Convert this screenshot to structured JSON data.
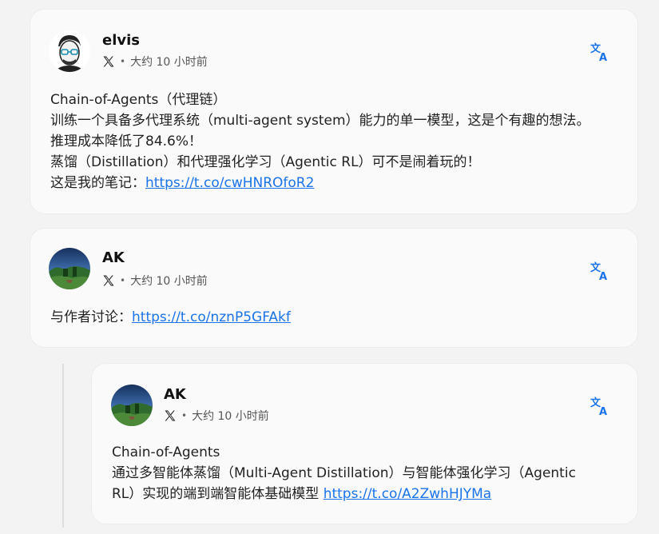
{
  "posts": [
    {
      "author": "elvis",
      "time": "大约 10 小时前",
      "lines": [
        "Chain-of-Agents（代理链）",
        "训练一个具备多代理系统（multi-agent system）能力的单一模型，这是个有趣的想法。",
        "推理成本降低了84.6%！",
        "蒸馏（Distillation）和代理强化学习（Agentic RL）可不是闹着玩的！"
      ],
      "link_prefix": "这是我的笔记：",
      "link": "https://t.co/cwHNROfoR2"
    },
    {
      "author": "AK",
      "time": "大约 10 小时前",
      "link_prefix": "与作者讨论：",
      "link": "https://t.co/nznP5GFAkf"
    },
    {
      "author": "AK",
      "time": "大约 10 小时前",
      "lines": [
        "Chain-of-Agents",
        "通过多智能体蒸馏（Multi-Agent Distillation）与智能体强化学习（Agentic"
      ],
      "link_prefix": "RL）实现的端到端智能体基础模型 ",
      "link": "https://t.co/A2ZwhHJYMa"
    }
  ],
  "icons": {
    "source": "x-logo-icon",
    "separator": "•",
    "translate": "translate-icon"
  },
  "colors": {
    "link": "#1a73e8",
    "translate": "#1a73e8"
  }
}
